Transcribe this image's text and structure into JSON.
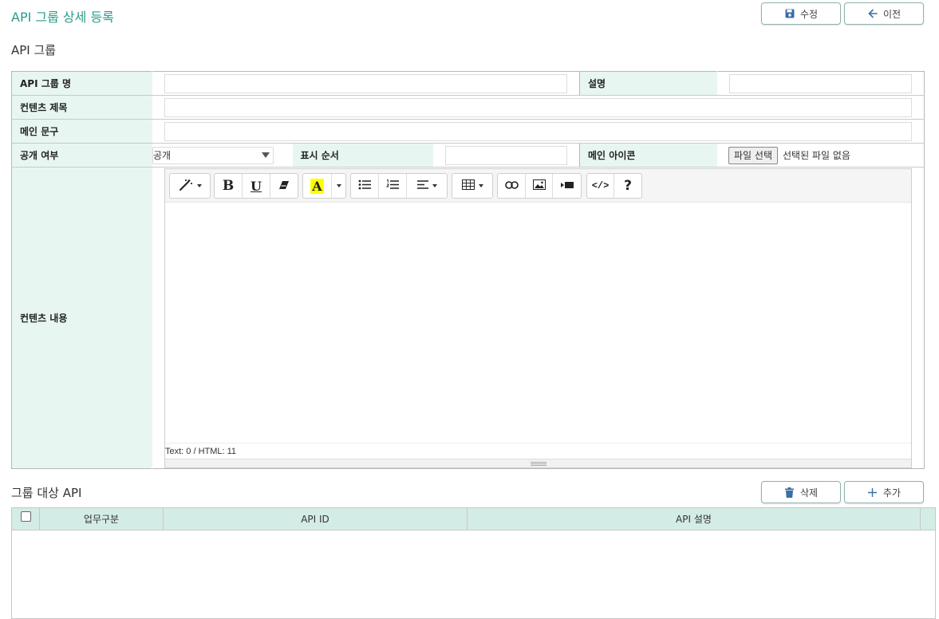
{
  "header": {
    "title": "API 그룹 상세 등록",
    "edit_button": "수정",
    "back_button": "이전"
  },
  "section1": {
    "title": "API 그룹"
  },
  "form": {
    "group_name_label": "API 그룹 명",
    "description_label": "설명",
    "content_title_label": "컨텐츠 제목",
    "main_text_label": "메인 문구",
    "public_label": "공개 여부",
    "public_value": "공개",
    "display_order_label": "표시 순서",
    "main_icon_label": "메인 아이콘",
    "file_button": "파일 선택",
    "file_status": "선택된 파일 없음",
    "content_label": "컨텐츠 내용"
  },
  "editor": {
    "status": "Text: 0 / HTML: 11",
    "toolbar_icons": [
      "magic-icon",
      "bold-icon",
      "underline-icon",
      "eraser-icon",
      "text-color-icon",
      "unordered-list-icon",
      "ordered-list-icon",
      "align-icon",
      "table-icon",
      "link-icon",
      "image-icon",
      "video-icon",
      "code-view-icon",
      "help-icon"
    ]
  },
  "section2": {
    "title": "그룹 대상 API",
    "delete_button": "삭제",
    "add_button": "추가"
  },
  "grid": {
    "columns": [
      "업무구분",
      "API ID",
      "API 설명"
    ]
  },
  "colors": {
    "accent": "#2a9c8c",
    "label_bg": "#e8f6f1",
    "grid_header_bg": "#d4ece6",
    "button_icon": "#3a6ea5"
  }
}
